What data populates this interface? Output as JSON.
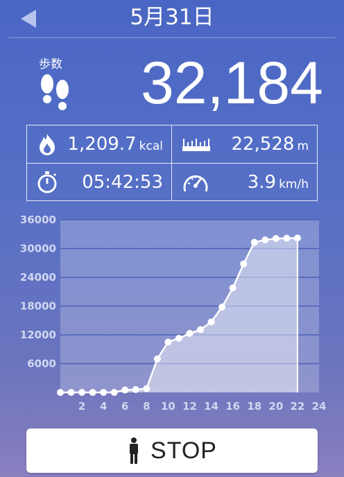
{
  "header": {
    "date_title": "5月31日"
  },
  "steps": {
    "label": "歩数",
    "value": "32,184"
  },
  "stats": {
    "calories": {
      "value": "1,209.7",
      "unit": "kcal"
    },
    "distance": {
      "value": "22,528",
      "unit": "m"
    },
    "duration": {
      "value": "05:42:53",
      "unit": ""
    },
    "speed": {
      "value": "3.9",
      "unit": "km/h"
    }
  },
  "chart_data": {
    "type": "area",
    "title": "",
    "xlabel": "",
    "ylabel": "",
    "xlim": [
      0,
      24
    ],
    "ylim": [
      0,
      36000
    ],
    "x_ticks": [
      2,
      4,
      6,
      8,
      10,
      12,
      14,
      16,
      18,
      20,
      22,
      24
    ],
    "y_ticks": [
      6000,
      12000,
      18000,
      24000,
      30000,
      36000
    ],
    "grid": true,
    "x": [
      0,
      1,
      2,
      3,
      4,
      5,
      6,
      7,
      8,
      9,
      10,
      11,
      12,
      13,
      14,
      15,
      16,
      17,
      18,
      19,
      20,
      21,
      22
    ],
    "values": [
      0,
      0,
      0,
      0,
      0,
      0,
      500,
      600,
      800,
      7000,
      10500,
      11300,
      12300,
      13100,
      14700,
      17800,
      21800,
      26800,
      31300,
      31800,
      32100,
      32150,
      32184
    ],
    "colors": {
      "line": "#ffffff",
      "fill": "rgba(255,255,255,0.45)",
      "plot_bg": "rgba(200,205,235,0.35)",
      "grid": "#4a5fb8"
    }
  },
  "stop_button": {
    "label": "STOP"
  }
}
